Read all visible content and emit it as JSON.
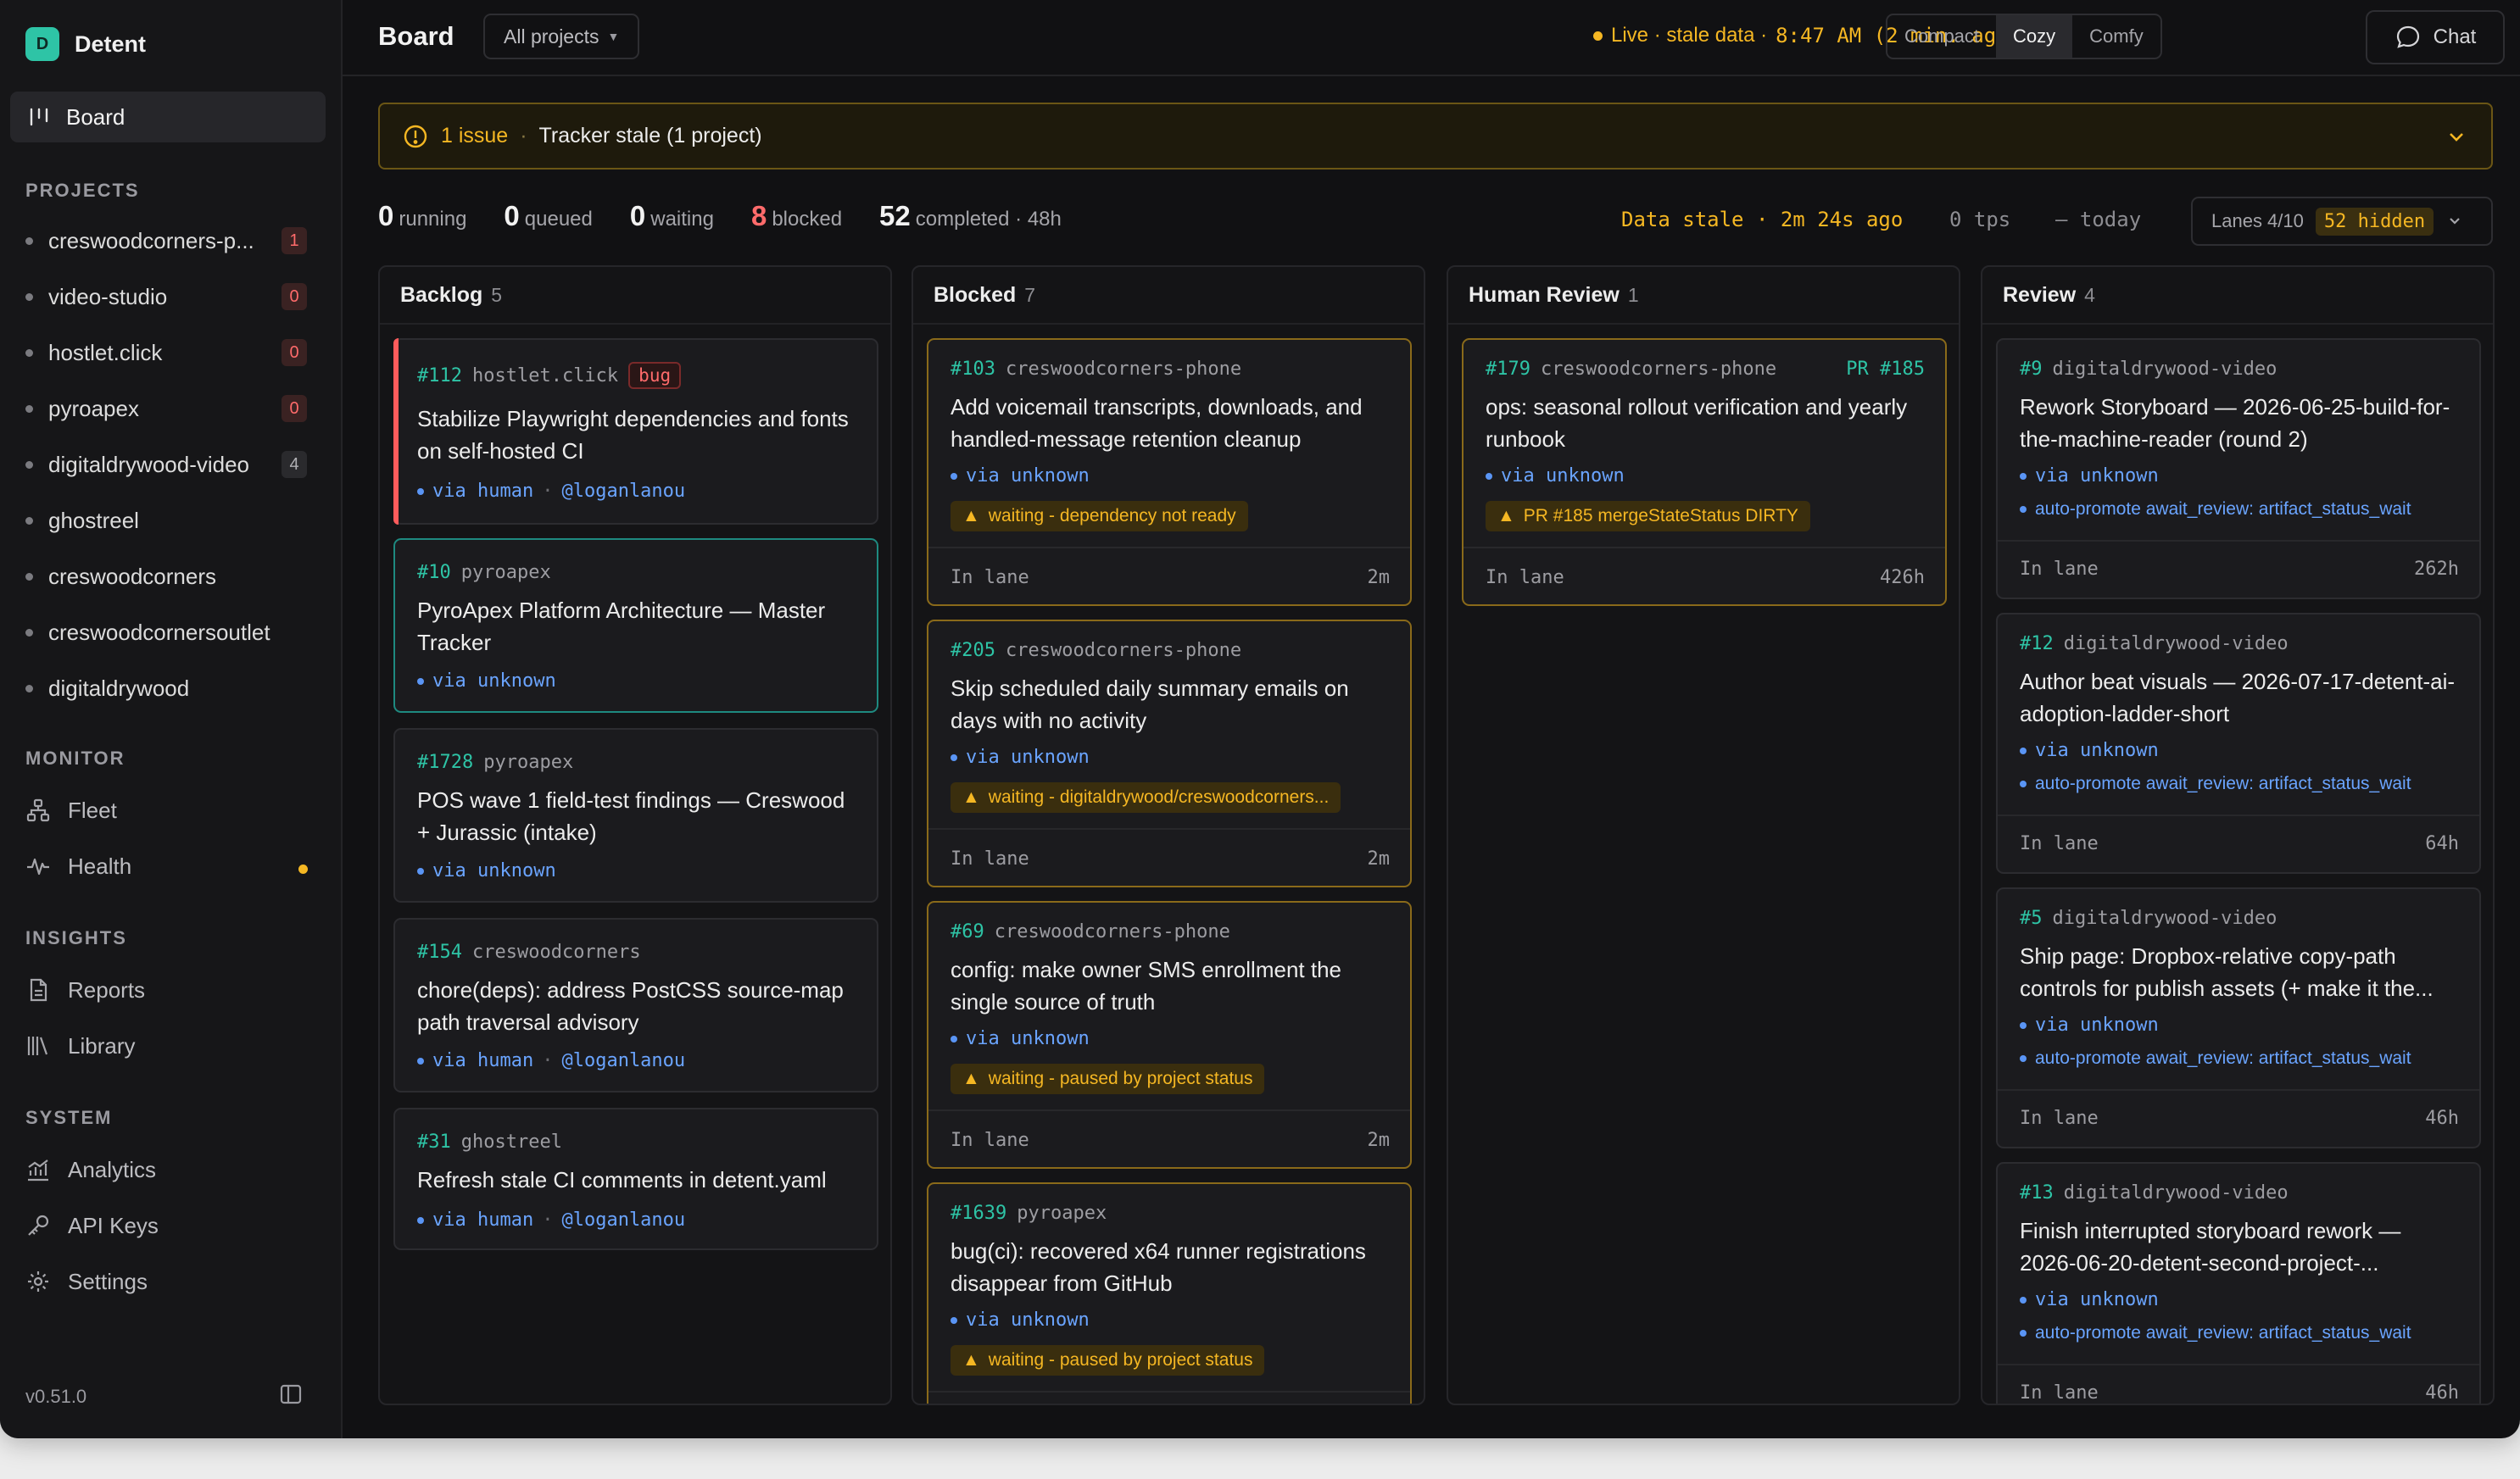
{
  "app": {
    "logo_letter": "D",
    "name": "Detent",
    "version": "v0.51.0"
  },
  "sidebar": {
    "board_label": "Board",
    "projects_heading": "PROJECTS",
    "projects": [
      {
        "name": "creswoodcorners-p...",
        "count": "1",
        "count_color": "red"
      },
      {
        "name": "video-studio",
        "count": "0",
        "count_color": "red"
      },
      {
        "name": "hostlet.click",
        "count": "0",
        "count_color": "red"
      },
      {
        "name": "pyroapex",
        "count": "0",
        "count_color": "red"
      },
      {
        "name": "digitaldrywood-video",
        "count": "4",
        "count_color": "gray"
      },
      {
        "name": "ghostreel",
        "count": ""
      },
      {
        "name": "creswoodcorners",
        "count": ""
      },
      {
        "name": "creswoodcornersoutlet",
        "count": ""
      },
      {
        "name": "digitaldrywood",
        "count": ""
      }
    ],
    "monitor_heading": "MONITOR",
    "fleet_label": "Fleet",
    "health_label": "Health",
    "insights_heading": "INSIGHTS",
    "reports_label": "Reports",
    "library_label": "Library",
    "system_heading": "SYSTEM",
    "analytics_label": "Analytics",
    "apikeys_label": "API Keys",
    "settings_label": "Settings"
  },
  "topbar": {
    "title": "Board",
    "project_select": "All projects",
    "live_label": "Live · stale data ·",
    "live_time": "8:47 AM (2 min. ago)",
    "density": [
      "Compact",
      "Cozy",
      "Comfy"
    ],
    "density_active": "Cozy",
    "chat_label": "Chat"
  },
  "banner": {
    "count": "1 issue",
    "separator": "·",
    "text": "Tracker stale (1 project)"
  },
  "stats": {
    "running": "0",
    "running_label": "running",
    "queued": "0",
    "queued_label": "queued",
    "waiting": "0",
    "waiting_label": "waiting",
    "blocked": "8",
    "blocked_label": "blocked",
    "completed": "52",
    "completed_label": "completed · 48h",
    "stale": "Data stale · 2m 24s ago",
    "tps": "0 tps",
    "today": "– today",
    "lanes_label": "Lanes 4/10",
    "hidden_label": "52 hidden"
  },
  "columns": [
    {
      "title": "Backlog",
      "count": "5"
    },
    {
      "title": "Blocked",
      "count": "7"
    },
    {
      "title": "Human Review",
      "count": "1"
    },
    {
      "title": "Review",
      "count": "4"
    }
  ],
  "backlog_cards": [
    {
      "id": "#112",
      "project": "hostlet.click",
      "badge": "bug",
      "title": "Stabilize Playwright dependencies and fonts on self-hosted CI",
      "via": "via human",
      "user": "@loganlanou"
    },
    {
      "id": "#10",
      "project": "pyroapex",
      "title": "PyroApex Platform Architecture — Master Tracker",
      "via": "via unknown"
    },
    {
      "id": "#1728",
      "project": "pyroapex",
      "title": "POS wave 1 field-test findings — Creswood + Jurassic (intake)",
      "via": "via unknown"
    },
    {
      "id": "#154",
      "project": "creswoodcorners",
      "title": "chore(deps): address PostCSS source-map path traversal advisory",
      "via": "via human",
      "user": "@loganlanou"
    },
    {
      "id": "#31",
      "project": "ghostreel",
      "title": "Refresh stale CI comments in detent.yaml",
      "via": "via human",
      "user": "@loganlanou"
    }
  ],
  "blocked_cards": [
    {
      "id": "#103",
      "project": "creswoodcorners-phone",
      "title": "Add voicemail transcripts, downloads, and handled-message retention cleanup",
      "via": "via unknown",
      "warn": "waiting - dependency not ready",
      "lane": "In lane",
      "age": "2m"
    },
    {
      "id": "#205",
      "project": "creswoodcorners-phone",
      "title": "Skip scheduled daily summary emails on days with no activity",
      "via": "via unknown",
      "warn": "waiting - digitaldrywood/creswoodcorners...",
      "lane": "In lane",
      "age": "2m"
    },
    {
      "id": "#69",
      "project": "creswoodcorners-phone",
      "title": "config: make owner SMS enrollment the single source of truth",
      "via": "via unknown",
      "warn": "waiting - paused by project status",
      "lane": "In lane",
      "age": "2m"
    },
    {
      "id": "#1639",
      "project": "pyroapex",
      "title": "bug(ci): recovered x64 runner registrations disappear from GitHub",
      "via": "via unknown",
      "warn": "waiting - paused by project status"
    }
  ],
  "human_review_cards": [
    {
      "id": "#179",
      "project": "creswoodcorners-phone",
      "pr": "PR #185",
      "title": "ops: seasonal rollout verification and yearly runbook",
      "via": "via unknown",
      "warn": "PR #185 mergeStateStatus DIRTY",
      "lane": "In lane",
      "age": "426h"
    }
  ],
  "review_cards": [
    {
      "id": "#9",
      "project": "digitaldrywood-video",
      "title": "Rework Storyboard — 2026-06-25-build-for-the-machine-reader (round 2)",
      "via": "via unknown",
      "auto": "auto-promote await_review: artifact_status_wait",
      "lane": "In lane",
      "age": "262h"
    },
    {
      "id": "#12",
      "project": "digitaldrywood-video",
      "title": "Author beat visuals — 2026-07-17-detent-ai-adoption-ladder-short",
      "via": "via unknown",
      "auto": "auto-promote await_review: artifact_status_wait",
      "lane": "In lane",
      "age": "64h"
    },
    {
      "id": "#5",
      "project": "digitaldrywood-video",
      "title": "Ship page: Dropbox-relative copy-path controls for publish assets (+ make it the...",
      "via": "via unknown",
      "auto": "auto-promote await_review: artifact_status_wait",
      "lane": "In lane",
      "age": "46h"
    },
    {
      "id": "#13",
      "project": "digitaldrywood-video",
      "title": "Finish interrupted storyboard rework — 2026-06-20-detent-second-project-...",
      "via": "via unknown",
      "auto": "auto-promote await_review: artifact_status_wait",
      "lane": "In lane",
      "age": "46h"
    }
  ],
  "colors": {
    "accent": "#2ec4a6",
    "amber": "#f5b723",
    "danger": "#ff6b6b",
    "link": "#6aa4ff"
  }
}
